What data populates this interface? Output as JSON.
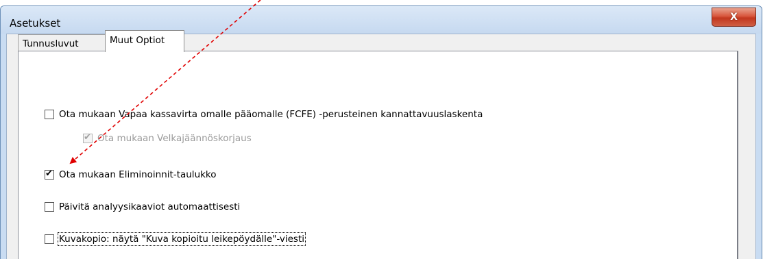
{
  "window": {
    "title": "Asetukset",
    "close_label": "X"
  },
  "tabs": [
    {
      "label": "Tunnusluvut",
      "selected": false
    },
    {
      "label": "Muut Optiot",
      "selected": true
    }
  ],
  "options": [
    {
      "label": "Ota mukaan Vapaa kassavirta omalle pääomalle (FCFE) -perusteinen kannattavuuslaskenta",
      "checked": false,
      "enabled": true
    },
    {
      "label": "Ota mukaan Velkajäännöskorjaus",
      "checked": true,
      "enabled": false
    },
    {
      "label": "Ota mukaan Eliminoinnit-taulukko",
      "checked": true,
      "enabled": true
    },
    {
      "label": "Päivitä analyysikaaviot automaattisesti",
      "checked": false,
      "enabled": true
    },
    {
      "label": "Kuvakopio: näytä \"Kuva kopioitu leikepöydälle\"-viesti",
      "checked": false,
      "enabled": true,
      "focused": true
    }
  ],
  "annotation": {
    "color": "#e00000",
    "style": "dashed-arrow"
  }
}
